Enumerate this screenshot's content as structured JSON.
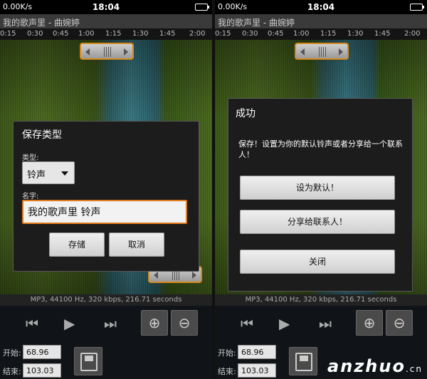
{
  "status": {
    "speed": "0.00K/s",
    "icons": "ψ ✉ ◔",
    "time": "18:04"
  },
  "app": {
    "title": "我的歌声里 - 曲婉婷"
  },
  "timeline": {
    "ticks": [
      "0:15",
      "0:30",
      "0:45",
      "1:00",
      "1:15",
      "1:30",
      "1:45",
      "2:00"
    ]
  },
  "info": {
    "line": "MP3, 44100 Hz, 320 kbps, 216.71 seconds"
  },
  "controls": {
    "start_label": "开始:",
    "start_value": "68.96",
    "end_label": "结束:",
    "end_value": "103.03"
  },
  "save_dialog": {
    "title": "保存类型",
    "type_label": "类型:",
    "type_value": "铃声",
    "name_label": "名字:",
    "name_value": "我的歌声里 铃声",
    "save_button": "存储",
    "cancel_button": "取消"
  },
  "success_dialog": {
    "title": "成功",
    "message": "保存！设置为你的默认铃声或者分享给一个联系人！",
    "default_button": "设为默认！",
    "share_button": "分享给联系人！",
    "close_button": "关闭"
  },
  "watermark": {
    "brand": "anzhuo",
    "suffix": ".cn"
  },
  "colors": {
    "accent": "#e07a1c",
    "waveform_green": "#4d6a22",
    "waveform_cyan": "#3b7a85"
  }
}
